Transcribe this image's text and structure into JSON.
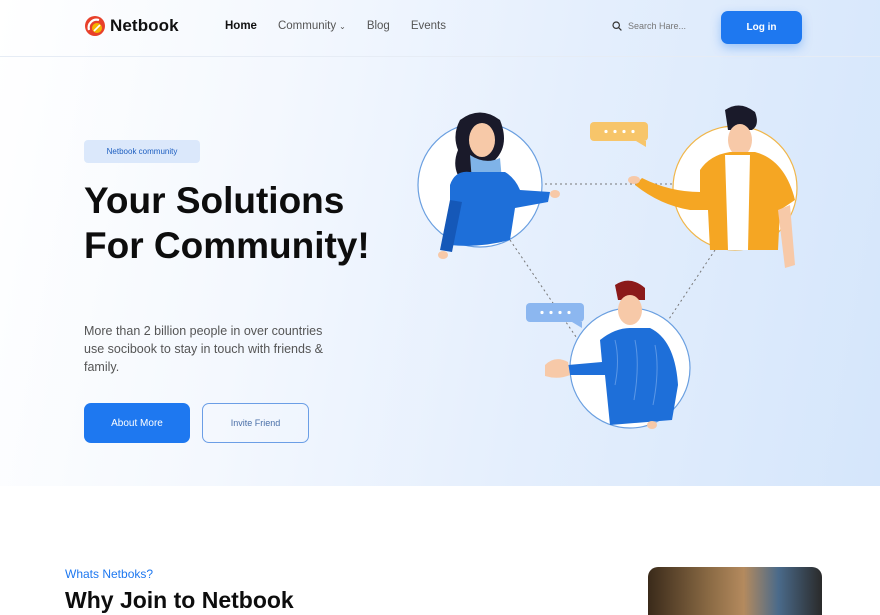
{
  "brand": {
    "name": "Netbook",
    "accent": "#1e78f0"
  },
  "nav": {
    "items": [
      {
        "label": "Home",
        "active": true
      },
      {
        "label": "Community",
        "has_dropdown": true
      },
      {
        "label": "Blog"
      },
      {
        "label": "Events"
      }
    ]
  },
  "search": {
    "placeholder": "Search Hare..."
  },
  "header": {
    "login_label": "Log in"
  },
  "hero": {
    "badge": "Netbook community",
    "title": "Your Solutions For Community!",
    "description": "More than 2 billion people in over countries use socibook to stay in touch with friends & family.",
    "primary_button": "About More",
    "secondary_button": "Invite Friend"
  },
  "section": {
    "eyebrow": "Whats Netboks?",
    "title": "Why Join to Netbook"
  }
}
